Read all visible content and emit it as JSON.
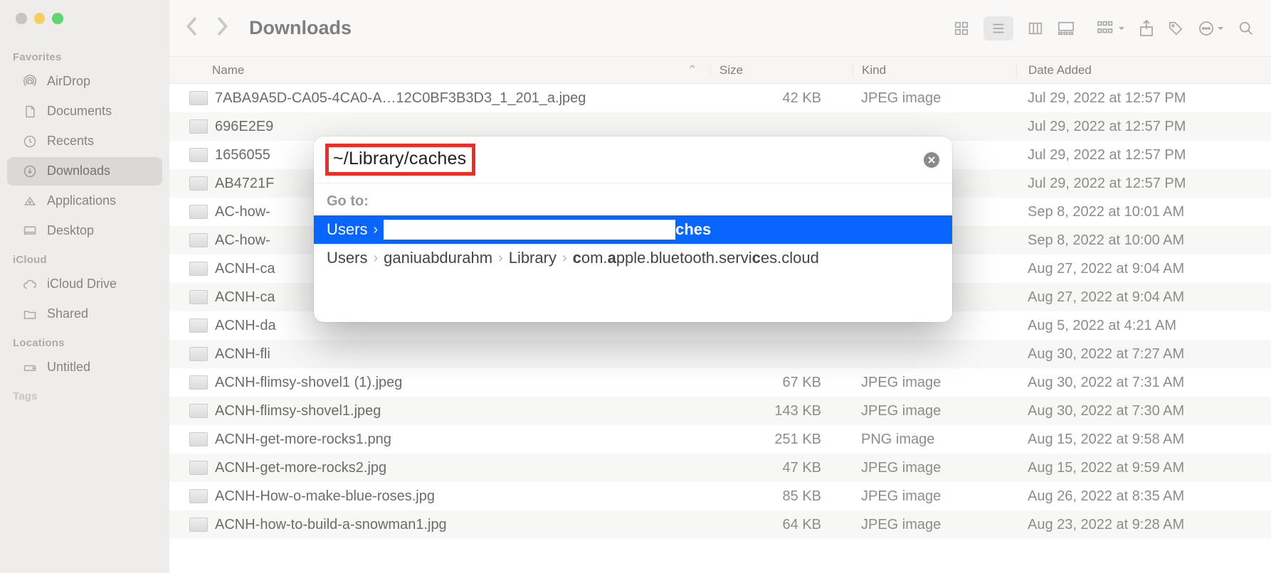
{
  "window": {
    "title": "Downloads"
  },
  "sidebar": {
    "sections": [
      {
        "heading": "Favorites",
        "items": [
          {
            "label": "AirDrop",
            "icon": "airdrop"
          },
          {
            "label": "Documents",
            "icon": "document"
          },
          {
            "label": "Recents",
            "icon": "clock"
          },
          {
            "label": "Downloads",
            "icon": "download",
            "active": true
          },
          {
            "label": "Applications",
            "icon": "apps"
          },
          {
            "label": "Desktop",
            "icon": "desktop"
          }
        ]
      },
      {
        "heading": "iCloud",
        "items": [
          {
            "label": "iCloud Drive",
            "icon": "cloud"
          },
          {
            "label": "Shared",
            "icon": "folder"
          }
        ]
      },
      {
        "heading": "Locations",
        "items": [
          {
            "label": "Untitled",
            "icon": "disk"
          }
        ]
      }
    ],
    "tags_heading": "Tags"
  },
  "columns": {
    "name": "Name",
    "size": "Size",
    "kind": "Kind",
    "date": "Date Added"
  },
  "files": [
    {
      "name": "7ABA9A5D-CA05-4CA0-A…12C0BF3B3D3_1_201_a.jpeg",
      "size": "42 KB",
      "kind": "JPEG image",
      "date": "Jul 29, 2022 at 12:57 PM"
    },
    {
      "name": "696E2E9",
      "size": "",
      "kind": "",
      "date": "Jul 29, 2022 at 12:57 PM"
    },
    {
      "name": "1656055",
      "size": "",
      "kind": "",
      "date": "Jul 29, 2022 at 12:57 PM"
    },
    {
      "name": "AB4721F",
      "size": "",
      "kind": "",
      "date": "Jul 29, 2022 at 12:57 PM"
    },
    {
      "name": "AC-how-",
      "size": "",
      "kind": "",
      "date": "Sep 8, 2022 at 10:01 AM"
    },
    {
      "name": "AC-how-",
      "size": "",
      "kind": "",
      "date": "Sep 8, 2022 at 10:00 AM"
    },
    {
      "name": "ACNH-ca",
      "size": "",
      "kind": "",
      "date": "Aug 27, 2022 at 9:04 AM"
    },
    {
      "name": "ACNH-ca",
      "size": "",
      "kind": "",
      "date": "Aug 27, 2022 at 9:04 AM"
    },
    {
      "name": "ACNH-da",
      "size": "",
      "kind": "",
      "date": "Aug 5, 2022 at 4:21 AM"
    },
    {
      "name": "ACNH-fli",
      "size": "",
      "kind": "",
      "date": "Aug 30, 2022 at 7:27 AM"
    },
    {
      "name": "ACNH-flimsy-shovel1 (1).jpeg",
      "size": "67 KB",
      "kind": "JPEG image",
      "date": "Aug 30, 2022 at 7:31 AM"
    },
    {
      "name": "ACNH-flimsy-shovel1.jpeg",
      "size": "143 KB",
      "kind": "JPEG image",
      "date": "Aug 30, 2022 at 7:30 AM"
    },
    {
      "name": "ACNH-get-more-rocks1.png",
      "size": "251 KB",
      "kind": "PNG image",
      "date": "Aug 15, 2022 at 9:58 AM"
    },
    {
      "name": "ACNH-get-more-rocks2.jpg",
      "size": "47 KB",
      "kind": "JPEG image",
      "date": "Aug 15, 2022 at 9:59 AM"
    },
    {
      "name": "ACNH-How-o-make-blue-roses.jpg",
      "size": "85 KB",
      "kind": "JPEG image",
      "date": "Aug 26, 2022 at 8:35 AM"
    },
    {
      "name": "ACNH-how-to-build-a-snowman1.jpg",
      "size": "64 KB",
      "kind": "JPEG image",
      "date": "Aug 23, 2022 at 9:28 AM"
    }
  ],
  "goto": {
    "input_value": "~/Library/caches",
    "label": "Go to:",
    "suggestions": [
      {
        "selected": true,
        "crumbs_prefix": "Users",
        "redacted": true,
        "crumbs_suffix": "ches"
      },
      {
        "selected": false,
        "crumbs": [
          "Users",
          "ganiuabdurahm",
          "Library",
          "com.apple.bluetooth.services.cloud"
        ]
      }
    ]
  }
}
